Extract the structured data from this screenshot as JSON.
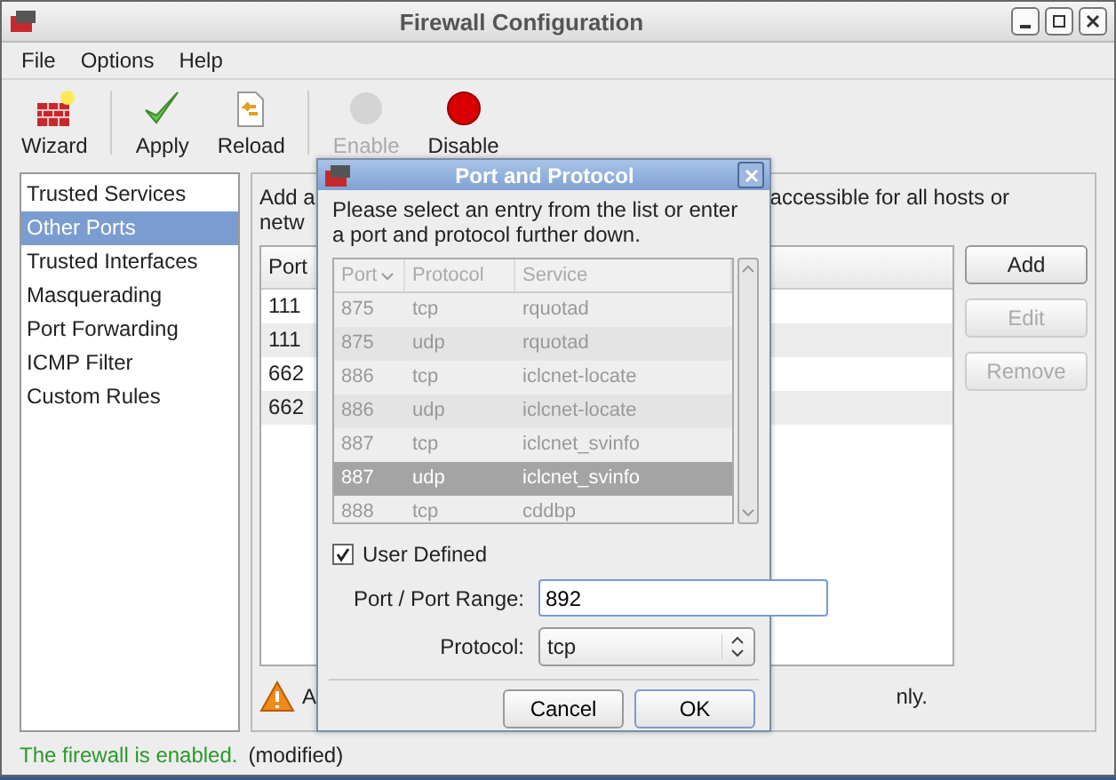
{
  "window": {
    "title": "Firewall Configuration"
  },
  "menu": [
    "File",
    "Options",
    "Help"
  ],
  "toolbar": [
    {
      "kind": "wizard",
      "label": "Wizard",
      "disabled": false
    },
    {
      "kind": "apply",
      "label": "Apply",
      "disabled": false
    },
    {
      "kind": "reload",
      "label": "Reload",
      "disabled": false
    },
    {
      "kind": "enable",
      "label": "Enable",
      "disabled": true
    },
    {
      "kind": "disable",
      "label": "Disable",
      "disabled": false
    }
  ],
  "sidebar": {
    "items": [
      {
        "label": "Trusted Services",
        "selected": false
      },
      {
        "label": "Other Ports",
        "selected": true
      },
      {
        "label": "Trusted Interfaces",
        "selected": false
      },
      {
        "label": "Masquerading",
        "selected": false
      },
      {
        "label": "Port Forwarding",
        "selected": false
      },
      {
        "label": "ICMP Filter",
        "selected": false
      },
      {
        "label": "Custom Rules",
        "selected": false
      }
    ]
  },
  "panel": {
    "description_left": "Add a",
    "description_right": "accessible for all hosts or",
    "description_line2": "netw",
    "table": {
      "columns": [
        "Port"
      ],
      "rows": [
        "111",
        "111",
        "662",
        "662"
      ]
    },
    "buttons": [
      {
        "label": "Add",
        "disabled": false
      },
      {
        "label": "Edit",
        "disabled": true
      },
      {
        "label": "Remove",
        "disabled": true
      }
    ],
    "warning_left": "A",
    "warning_right": "nly."
  },
  "status_bar": {
    "state": "The firewall is enabled.",
    "note": "(modified)"
  },
  "dialog": {
    "title": "Port and Protocol",
    "instructions": "Please select an entry from the list or enter a port and protocol further down.",
    "list": {
      "disabled": true,
      "columns": [
        "Port",
        "Protocol",
        "Service"
      ],
      "rows": [
        {
          "port": "875",
          "protocol": "tcp",
          "service": "rquotad",
          "selected": false
        },
        {
          "port": "875",
          "protocol": "udp",
          "service": "rquotad",
          "selected": false
        },
        {
          "port": "886",
          "protocol": "tcp",
          "service": "iclcnet-locate",
          "selected": false
        },
        {
          "port": "886",
          "protocol": "udp",
          "service": "iclcnet-locate",
          "selected": false
        },
        {
          "port": "887",
          "protocol": "tcp",
          "service": "iclcnet_svinfo",
          "selected": false
        },
        {
          "port": "887",
          "protocol": "udp",
          "service": "iclcnet_svinfo",
          "selected": true
        },
        {
          "port": "888",
          "protocol": "tcp",
          "service": "cddbp",
          "selected": false
        }
      ]
    },
    "user_defined": {
      "label": "User Defined",
      "checked": true
    },
    "port_label": "Port / Port Range:",
    "port_value": "892",
    "protocol_label": "Protocol:",
    "protocol_value": "tcp",
    "buttons": [
      "Cancel",
      "OK"
    ]
  }
}
